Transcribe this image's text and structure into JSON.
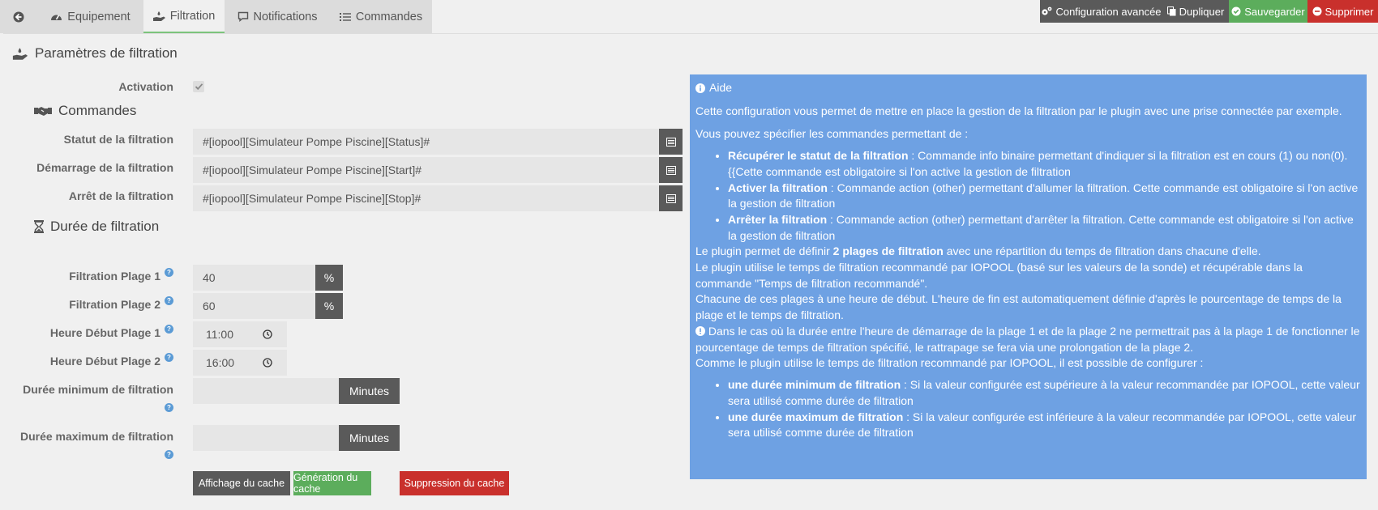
{
  "tabs": {
    "equipement": "Equipement",
    "filtration": "Filtration",
    "notifications": "Notifications",
    "commandes": "Commandes"
  },
  "toolbar": {
    "config": "Configuration avancée",
    "dupliquer": "Dupliquer",
    "sauvegarder": "Sauvegarder",
    "supprimer": "Supprimer"
  },
  "form": {
    "section_title": "Paramètres de filtration",
    "activation_label": "Activation",
    "activation_checked": true,
    "commandes_title": "Commandes",
    "statut_label": "Statut de la filtration",
    "statut_value": "#[iopool][Simulateur Pompe Piscine][Status]#",
    "demarrage_label": "Démarrage de la filtration",
    "demarrage_value": "#[iopool][Simulateur Pompe Piscine][Start]#",
    "arret_label": "Arrêt de la filtration",
    "arret_value": "#[iopool][Simulateur Pompe Piscine][Stop]#",
    "duree_title": "Durée de filtration",
    "plage1_label": "Filtration Plage 1",
    "plage1_value": "40",
    "plage2_label": "Filtration Plage 2",
    "plage2_value": "60",
    "percent": "%",
    "heure1_label": "Heure Début Plage 1",
    "heure1_value": "11:00",
    "heure2_label": "Heure Début Plage 2",
    "heure2_value": "16:00",
    "min_label": "Durée minimum de filtration",
    "min_value": "",
    "max_label": "Durée maximum de filtration",
    "max_value": "",
    "minutes": "Minutes",
    "help_mark": "?"
  },
  "cache_buttons": {
    "affichage": "Affichage du cache",
    "generation": "Génération du cache",
    "suppression": "Suppression du cache"
  },
  "help": {
    "title": "Aide",
    "intro": "Cette configuration vous permet de mettre en place la gestion de la filtration par le plugin avec une prise connectée par exemple.",
    "commands_intro": "Vous pouvez spécifier les commandes permettant de :",
    "bullets_1": [
      {
        "bold": "Récupérer le statut de la filtration",
        "text": " : Commande info binaire permettant d'indiquer si la filtration est en cours (1) ou non(0). {{Cette commande est obligatoire si l'on active la gestion de filtration"
      },
      {
        "bold": "Activer la filtration",
        "text": " : Commande action (other) permettant d'allumer la filtration. Cette commande est obligatoire si l'on active la gestion de filtration"
      },
      {
        "bold": "Arrêter la filtration",
        "text": " : Commande action (other) permettant d'arrêter la filtration. Cette commande est obligatoire si l'on active la gestion de filtration"
      }
    ],
    "plages_prefix": "Le plugin permet de définir ",
    "plages_bold": "2 plages de filtration",
    "plages_suffix": " avec une répartition du temps de filtration dans chacune d'elle.",
    "plages_line2": "Le plugin utilise le temps de filtration recommandé par IOPOOL (basé sur les valeurs de la sonde) et récupérable dans la commande \"Temps de filtration recommandé\".",
    "plages_line3": "Chacune de ces plages à une heure de début. L'heure de fin est automatiquement définie d'après le pourcentage de temps de la plage et le temps de filtration.",
    "plages_line4": "Dans le cas où la durée entre l'heure de démarrage de la plage 1 et de la plage 2 ne permettrait pas à la plage 1 de fonctionner le pourcentage de temps de filtration spécifié, le rattrapage se fera via une prolongation de la plage 2.",
    "minmax_intro": "Comme le plugin utilise le temps de filtration recommandé par IOPOOL, il est possible de configurer :",
    "bullets_2": [
      {
        "bold": "une durée minimum de filtration",
        "text": " : Si la valeur configurée est supérieure à la valeur recommandée par IOPOOL, cette valeur sera utilisé comme durée de filtration"
      },
      {
        "bold": "une durée maximum de filtration",
        "text": " : Si la valeur configurée est inférieure à la valeur recommandée par IOPOOL, cette valeur sera utilisé comme durée de filtration"
      }
    ]
  },
  "colors": {
    "help_bg": "#6ea1e3",
    "save": "#5cad5c",
    "delete": "#c9302c",
    "dark": "#5a5a5a"
  }
}
